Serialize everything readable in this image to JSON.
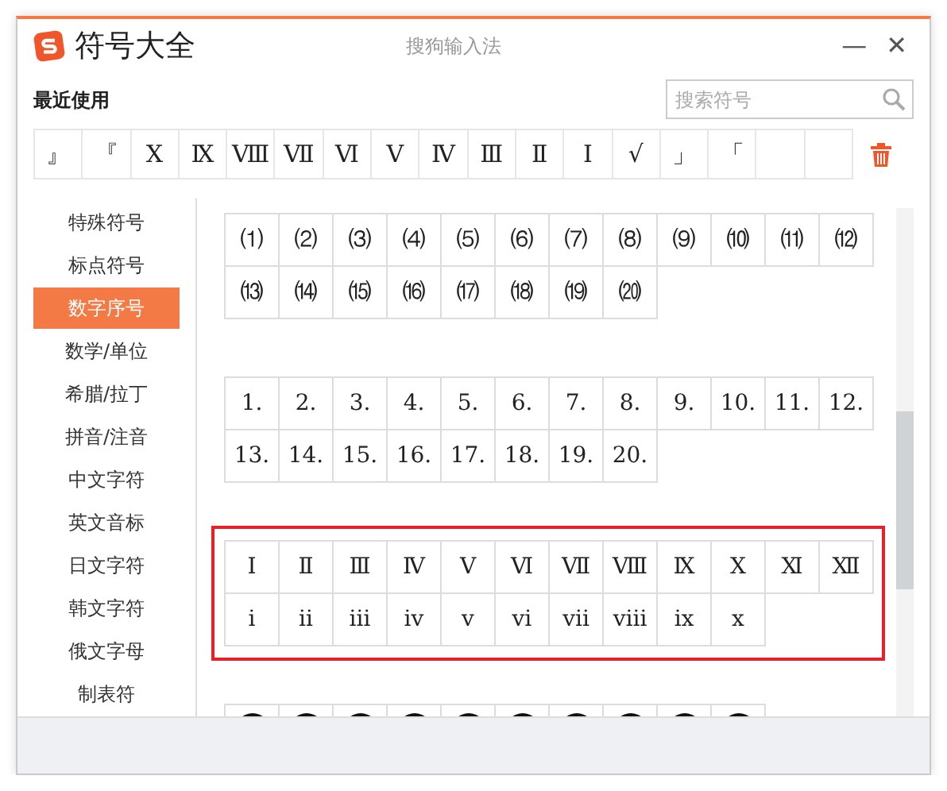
{
  "window": {
    "title": "符号大全",
    "app_name": "搜狗输入法",
    "minimize": "—",
    "close": "✕"
  },
  "recent": {
    "label": "最近使用",
    "items": [
      {
        "kind": "symbol",
        "symbol": "』"
      },
      {
        "kind": "symbol",
        "symbol": "『"
      },
      {
        "kind": "symbol",
        "symbol": "Ⅹ"
      },
      {
        "kind": "symbol",
        "symbol": "Ⅸ"
      },
      {
        "kind": "symbol",
        "symbol": "Ⅷ"
      },
      {
        "kind": "symbol",
        "symbol": "Ⅶ"
      },
      {
        "kind": "symbol",
        "symbol": "Ⅵ"
      },
      {
        "kind": "symbol",
        "symbol": "Ⅴ"
      },
      {
        "kind": "symbol",
        "symbol": "Ⅳ"
      },
      {
        "kind": "symbol",
        "symbol": "Ⅲ"
      },
      {
        "kind": "symbol",
        "symbol": "Ⅱ"
      },
      {
        "kind": "symbol",
        "symbol": "Ⅰ"
      },
      {
        "kind": "symbol",
        "symbol": "√"
      },
      {
        "kind": "symbol",
        "symbol": "」"
      },
      {
        "kind": "symbol",
        "symbol": "「"
      },
      {
        "kind": "empty"
      },
      {
        "kind": "empty"
      }
    ]
  },
  "search": {
    "placeholder": "搜索符号"
  },
  "sidebar": {
    "items": [
      {
        "label": "特殊符号",
        "selected": false
      },
      {
        "label": "标点符号",
        "selected": false
      },
      {
        "label": "数字序号",
        "selected": true
      },
      {
        "label": "数学/单位",
        "selected": false
      },
      {
        "label": "希腊/拉丁",
        "selected": false
      },
      {
        "label": "拼音/注音",
        "selected": false
      },
      {
        "label": "中文字符",
        "selected": false
      },
      {
        "label": "英文音标",
        "selected": false
      },
      {
        "label": "日文字符",
        "selected": false
      },
      {
        "label": "韩文字符",
        "selected": false
      },
      {
        "label": "俄文字母",
        "selected": false
      },
      {
        "label": "制表符",
        "selected": false
      }
    ]
  },
  "symbol_groups": [
    {
      "kind": "text",
      "highlighted": false,
      "symbols": [
        "⑴",
        "⑵",
        "⑶",
        "⑷",
        "⑸",
        "⑹",
        "⑺",
        "⑻",
        "⑼",
        "⑽",
        "⑾",
        "⑿",
        "⒀",
        "⒁",
        "⒂",
        "⒃",
        "⒄",
        "⒅",
        "⒆",
        "⒇"
      ]
    },
    {
      "kind": "text",
      "highlighted": false,
      "symbols": [
        "1.",
        "2.",
        "3.",
        "4.",
        "5.",
        "6.",
        "7.",
        "8.",
        "9.",
        "10.",
        "11.",
        "12.",
        "13.",
        "14.",
        "15.",
        "16.",
        "17.",
        "18.",
        "19.",
        "20."
      ]
    },
    {
      "kind": "text",
      "highlighted": true,
      "symbols": [
        "Ⅰ",
        "Ⅱ",
        "Ⅲ",
        "Ⅳ",
        "Ⅴ",
        "Ⅵ",
        "Ⅶ",
        "Ⅷ",
        "Ⅸ",
        "Ⅹ",
        "Ⅺ",
        "Ⅻ",
        "ⅰ",
        "ⅱ",
        "ⅲ",
        "ⅳ",
        "ⅴ",
        "ⅵ",
        "ⅶ",
        "ⅷ",
        "ⅸ",
        "ⅹ"
      ]
    },
    {
      "kind": "dark-circles",
      "highlighted": false,
      "cells": [
        {
          "kind": "dark-circle"
        },
        {
          "kind": "dark-circle"
        },
        {
          "kind": "dark-circle"
        },
        {
          "kind": "dark-circle"
        },
        {
          "kind": "dark-circle"
        },
        {
          "kind": "dark-circle"
        },
        {
          "kind": "dark-circle"
        },
        {
          "kind": "dark-circle"
        },
        {
          "kind": "dark-circle"
        },
        {
          "kind": "dark-circle"
        }
      ]
    }
  ]
}
